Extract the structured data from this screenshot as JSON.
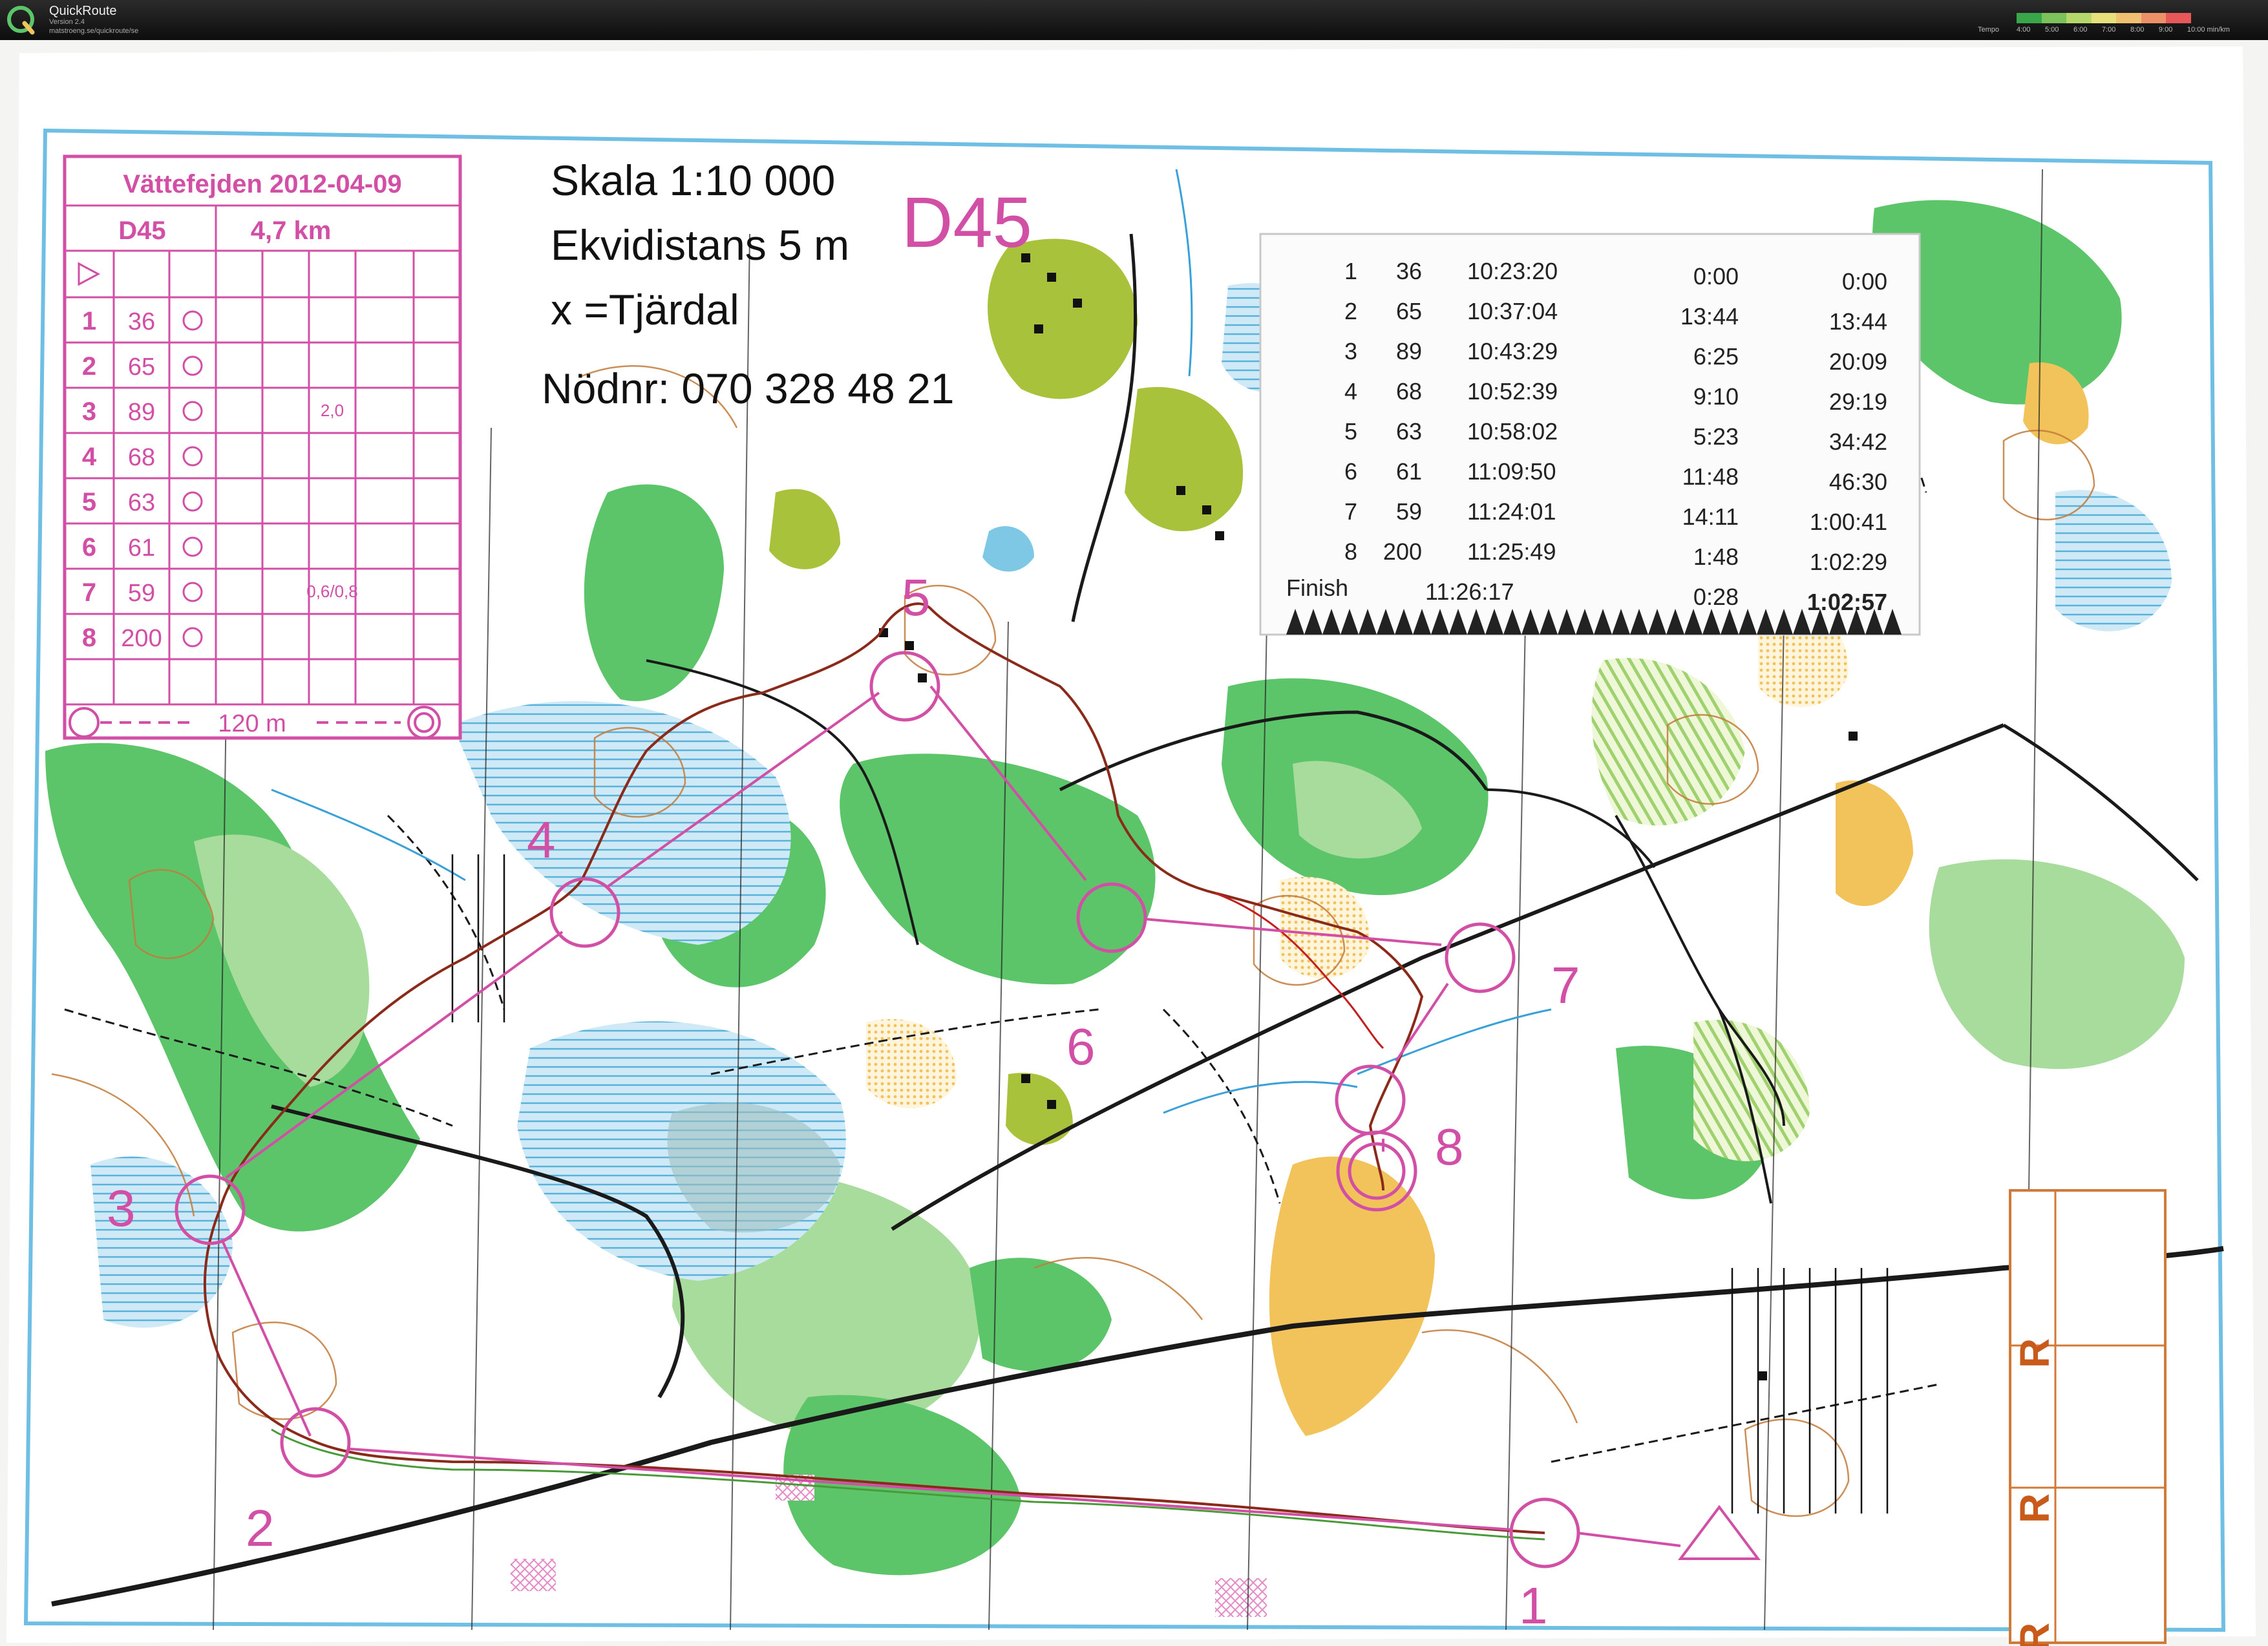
{
  "app": {
    "name": "QuickRoute",
    "version": "Version 2.4",
    "url": "matstroeng.se/quickroute/se"
  },
  "tempo": {
    "label": "Tempo",
    "ticks": [
      "4:00",
      "5:00",
      "6:00",
      "7:00",
      "8:00",
      "9:00",
      "10:00 min/km"
    ],
    "colors": [
      "#3aa64a",
      "#7cc25a",
      "#b6d86b",
      "#e8e07a",
      "#f1c070",
      "#ee9068",
      "#e85858"
    ]
  },
  "colors": {
    "magenta": "#d24fa6",
    "forest": "#5cc56a",
    "light_forest": "#a8dc9c",
    "open": "#f2c35a",
    "water": "#7ec8e6",
    "olive": "#a8c23c",
    "route": "#8a2a1a"
  },
  "map_info": {
    "scale": "Skala 1:10 000",
    "contour": "Ekvidistans 5 m",
    "note": "x =Tjärdal",
    "emergency": "Nödnr: 070 328 48 21",
    "class": "D45"
  },
  "control_description": {
    "event": "Vättefejden 2012-04-09",
    "class": "D45",
    "length": "4,7 km",
    "rows": [
      {
        "n": "1",
        "code": "36",
        "extra": ""
      },
      {
        "n": "2",
        "code": "65",
        "extra": ""
      },
      {
        "n": "3",
        "code": "89",
        "extra": "2,0"
      },
      {
        "n": "4",
        "code": "68",
        "extra": ""
      },
      {
        "n": "5",
        "code": "63",
        "extra": ""
      },
      {
        "n": "6",
        "code": "61",
        "extra": ""
      },
      {
        "n": "7",
        "code": "59",
        "extra": "0,6/0,8"
      },
      {
        "n": "8",
        "code": "200",
        "extra": ""
      }
    ],
    "finish_dist": "120 m"
  },
  "split_times": {
    "rows": [
      {
        "n": "1",
        "code": "36",
        "clock": "10:23:20",
        "leg": "0:00",
        "total": "0:00"
      },
      {
        "n": "2",
        "code": "65",
        "clock": "10:37:04",
        "leg": "13:44",
        "total": "13:44"
      },
      {
        "n": "3",
        "code": "89",
        "clock": "10:43:29",
        "leg": "6:25",
        "total": "20:09"
      },
      {
        "n": "4",
        "code": "68",
        "clock": "10:52:39",
        "leg": "9:10",
        "total": "29:19"
      },
      {
        "n": "5",
        "code": "63",
        "clock": "10:58:02",
        "leg": "5:23",
        "total": "34:42"
      },
      {
        "n": "6",
        "code": "61",
        "clock": "11:09:50",
        "leg": "11:48",
        "total": "46:30"
      },
      {
        "n": "7",
        "code": "59",
        "clock": "11:24:01",
        "leg": "14:11",
        "total": "1:00:41"
      },
      {
        "n": "8",
        "code": "200",
        "clock": "11:25:49",
        "leg": "1:48",
        "total": "1:02:29"
      }
    ],
    "finish": {
      "label": "Finish",
      "clock": "11:26:17",
      "leg": "0:28",
      "total": "1:02:57"
    }
  },
  "controls": [
    {
      "label": "1"
    },
    {
      "label": "2"
    },
    {
      "label": "3"
    },
    {
      "label": "4"
    },
    {
      "label": "5"
    },
    {
      "label": "6"
    },
    {
      "label": "7"
    },
    {
      "label": "8"
    }
  ],
  "margin_letters": [
    "R",
    "R",
    "R"
  ]
}
